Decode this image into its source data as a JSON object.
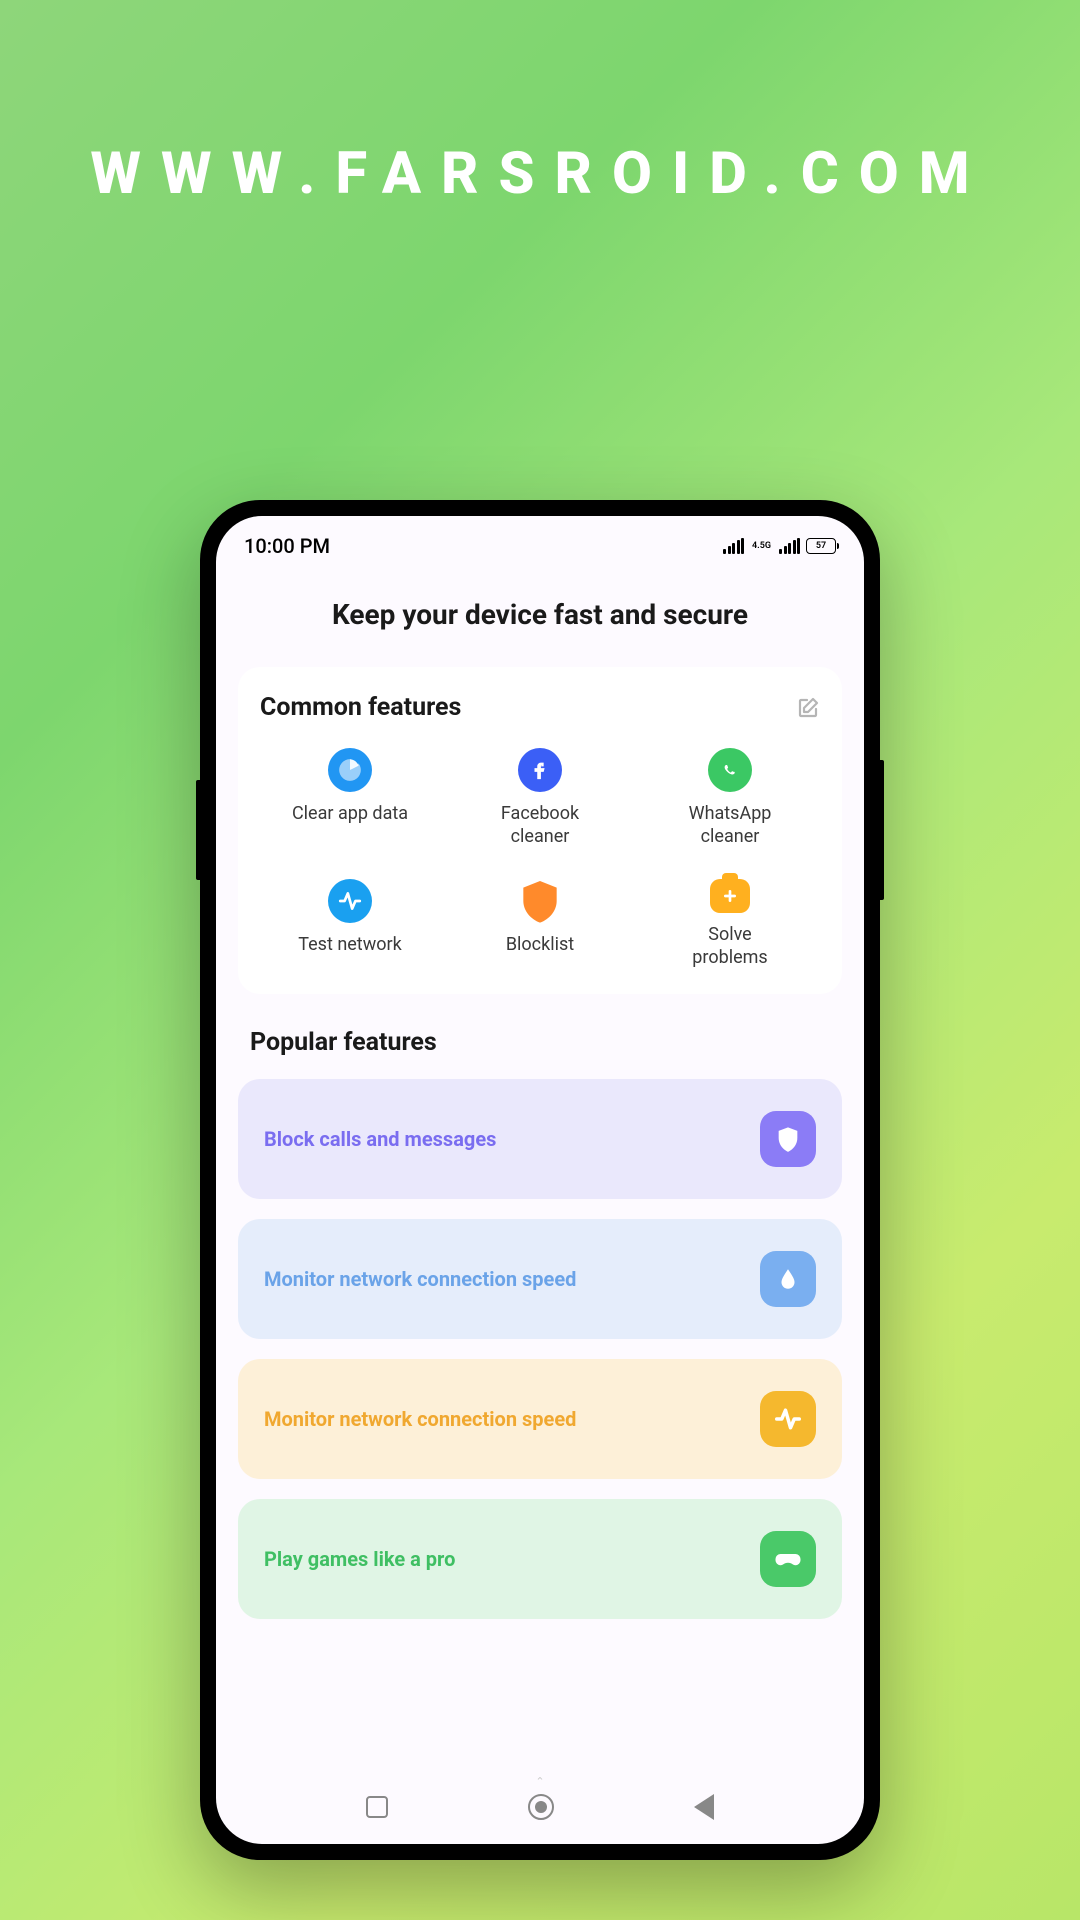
{
  "watermark": "WWW.FARSROID.COM",
  "status": {
    "time": "10:00 PM",
    "network": "4.5G",
    "battery": "57"
  },
  "page_title": "Keep your device fast and secure",
  "common": {
    "title": "Common features",
    "items": [
      {
        "label": "Clear app data",
        "icon": "pie-chart-icon",
        "color": "#2196f3"
      },
      {
        "label": "Facebook cleaner",
        "icon": "facebook-icon",
        "color": "#3b5ff6"
      },
      {
        "label": "WhatsApp cleaner",
        "icon": "whatsapp-icon",
        "color": "#3bc864"
      },
      {
        "label": "Test network",
        "icon": "activity-icon",
        "color": "#1aa0f0"
      },
      {
        "label": "Blocklist",
        "icon": "shield-icon",
        "color": "#ff8a2b"
      },
      {
        "label": "Solve problems",
        "icon": "toolbox-icon",
        "color": "#ffb01f"
      }
    ]
  },
  "popular": {
    "title": "Popular features",
    "items": [
      {
        "label": "Block calls and messages",
        "bg": "#eae8fc",
        "fg": "#7a6df0",
        "icon_bg": "#8b7cf6",
        "icon": "shield-white-icon"
      },
      {
        "label": "Monitor network connection speed",
        "bg": "#e5edfb",
        "fg": "#6aa3e8",
        "icon_bg": "#7aaff0",
        "icon": "drop-icon"
      },
      {
        "label": "Monitor network connection speed",
        "bg": "#fdf0d8",
        "fg": "#f0a830",
        "icon_bg": "#f5b82e",
        "icon": "pulse-icon"
      },
      {
        "label": "Play games like a pro",
        "bg": "#e0f5e5",
        "fg": "#3fbf63",
        "icon_bg": "#4ac969",
        "icon": "game-icon"
      }
    ]
  }
}
